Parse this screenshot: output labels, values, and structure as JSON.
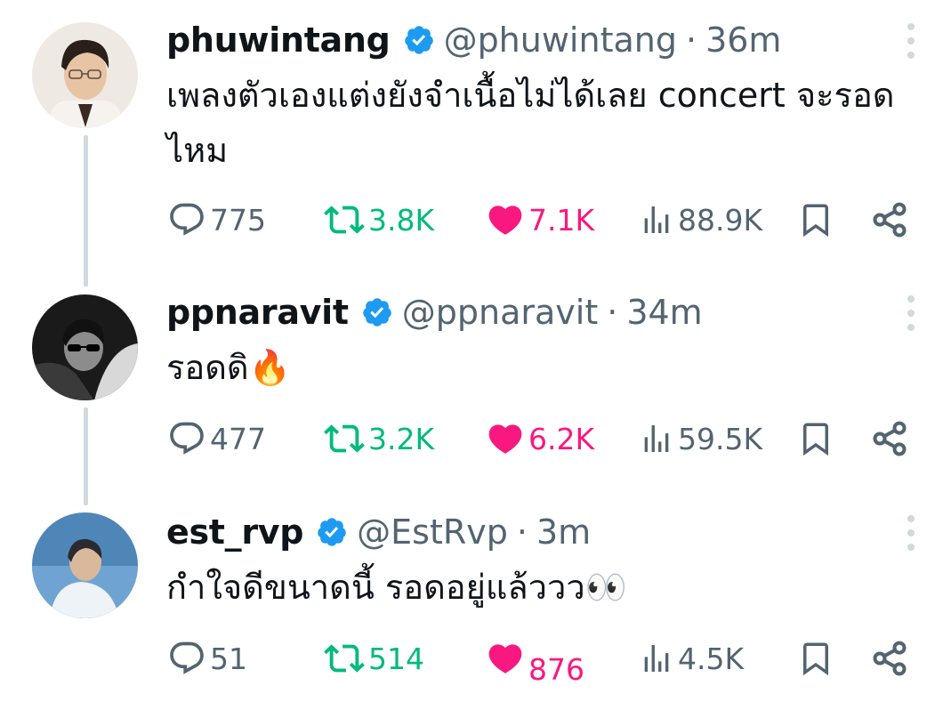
{
  "colors": {
    "text": "#0f1419",
    "secondary": "#536471",
    "verified": "#1d9bf0",
    "retweet": "#00ba7c",
    "like": "#f91880",
    "thread_line": "#cfd9de"
  },
  "tweets": [
    {
      "name": "phuwintang",
      "handle": "@phuwintang",
      "separator": "·",
      "time": "36m",
      "text": "เพลงตัวเองแต่งยังจำเนื้อไม่ได้เลย concert จะรอดไหม",
      "replies": "775",
      "retweets": "3.8K",
      "likes": "7.1K",
      "views": "88.9K",
      "liked": true
    },
    {
      "name": "ppnaravit",
      "handle": "@ppnaravit",
      "separator": "·",
      "time": "34m",
      "text": "รอดดิ🔥",
      "replies": "477",
      "retweets": "3.2K",
      "likes": "6.2K",
      "views": "59.5K",
      "liked": true
    },
    {
      "name": "est_rvp",
      "handle": "@EstRvp",
      "separator": "·",
      "time": "3m",
      "text": "กำใจดีขนาดนี้ รอดอยู่แล้ววว👀",
      "replies": "51",
      "retweets": "514",
      "likes": "876",
      "views": "4.5K",
      "liked": true
    }
  ]
}
